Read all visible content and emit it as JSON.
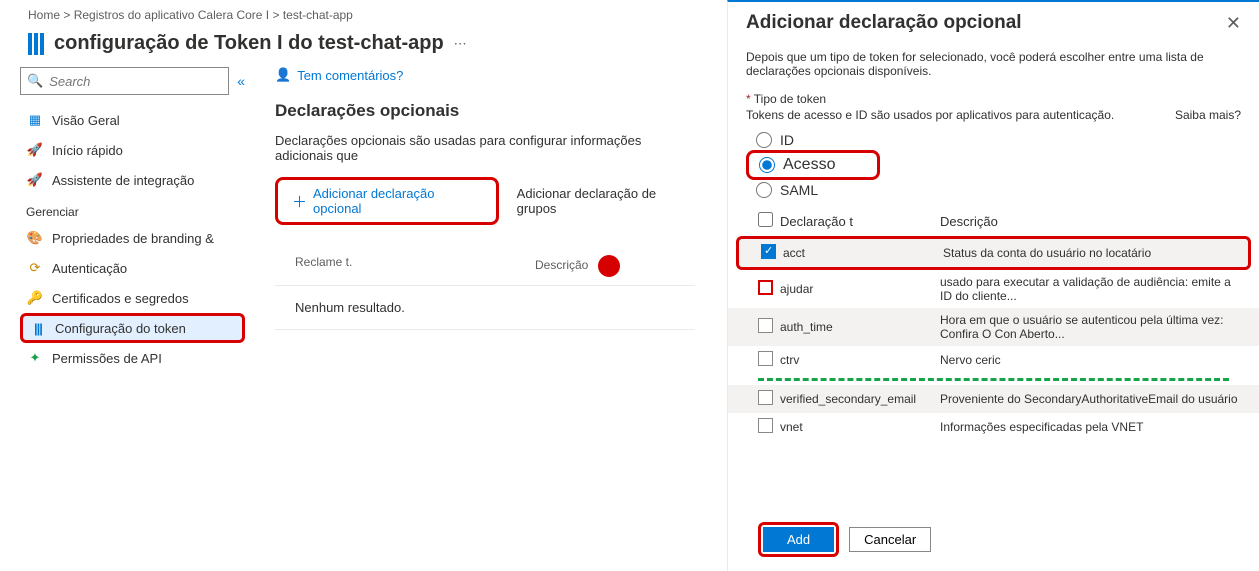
{
  "breadcrumb": {
    "home": "Home >",
    "middle": "Registros do aplicativo Calera Core I >",
    "last": "test-chat-app"
  },
  "page_title": "configuração de Token I do test-chat-app",
  "search": {
    "placeholder": "Search"
  },
  "nav": {
    "overview": "Visão Geral",
    "quickstart": "Início rápido",
    "integration": "Assistente de integração",
    "group_manage": "Gerenciar",
    "branding": "Propriedades de branding &",
    "auth": "Autenticação",
    "secrets": "Certificados e segredos",
    "token": "Configuração do token",
    "api": "Permissões de API"
  },
  "main": {
    "feedback": "Tem comentários?",
    "heading": "Declarações opcionais",
    "desc": "Declarações opcionais são usadas para configurar informações adicionais que",
    "add_claim": "Adicionar declaração opcional",
    "add_groups": "Adicionar declaração de grupos",
    "th_claim": "Reclame t.",
    "th_desc": "Descrição",
    "no_result": "Nenhum resultado."
  },
  "panel": {
    "title": "Adicionar declaração opcional",
    "info": "Depois que um tipo de token for selecionado, você poderá escolher entre uma lista de declarações opcionais disponíveis.",
    "label_token_type": "Tipo de token",
    "sub_info": "Tokens de acesso e ID são usados por aplicativos para autenticação.",
    "learn_more": "Saiba mais?",
    "radio_id": "ID",
    "radio_access": "Acesso",
    "radio_saml": "SAML",
    "th_claim": "Declaração t",
    "th_desc": "Descrição",
    "rows": [
      {
        "name": "acct",
        "desc": "Status da conta do usuário no locatário",
        "checked": true
      },
      {
        "name": "ajudar",
        "desc": "usado para executar a validação de audiência: emite a ID do cliente...",
        "checked": false,
        "redborder": true
      },
      {
        "name": "auth_time",
        "desc": "Hora em que o usuário se autenticou pela última vez: Confira O Con Aberto...",
        "checked": false
      },
      {
        "name": "ctrv",
        "desc": "Nervo ceric",
        "checked": false
      }
    ],
    "rows_tail": [
      {
        "name": "verified_secondary_email",
        "desc": "Proveniente do SecondaryAuthoritativeEmail do usuário",
        "checked": false
      },
      {
        "name": "vnet",
        "desc": "Informações especificadas pela VNET",
        "checked": false
      }
    ],
    "add": "Add",
    "cancel": "Cancelar"
  },
  "icons": {
    "search": "🔍",
    "collapse": "«",
    "overview": "▦",
    "quickstart": "🚀",
    "integration": "🚀",
    "branding": "🎨",
    "auth": "⟳",
    "secrets": "🔑",
    "token_bars": "|||",
    "api": "✦",
    "feedback": "👤",
    "close": "✕"
  }
}
